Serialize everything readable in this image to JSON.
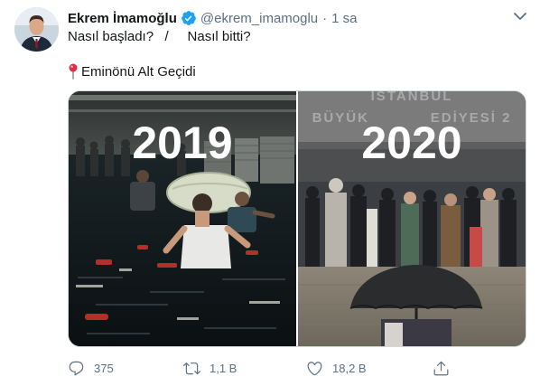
{
  "author": {
    "display_name": "Ekrem İmamoğlu",
    "handle": "@ekrem_imamoglu",
    "separator": "·",
    "timestamp": "1 sa"
  },
  "tweet": {
    "line1": "Nasıl başladı?   /     Nasıl bitti?",
    "location_text": "Eminönü Alt Geçidi"
  },
  "media": {
    "left_year": "2019",
    "right_year": "2020",
    "right_sign_line1": "İSTANBUL",
    "right_sign_line2": "BÜYÜK           EDİYESİ 2"
  },
  "actions": {
    "replies": "375",
    "retweets": "1,1 B",
    "likes": "18,2 B"
  },
  "colors": {
    "verified_blue": "#1da1f2",
    "muted_text": "#5b7083",
    "pin_red": "#dd2e44"
  }
}
